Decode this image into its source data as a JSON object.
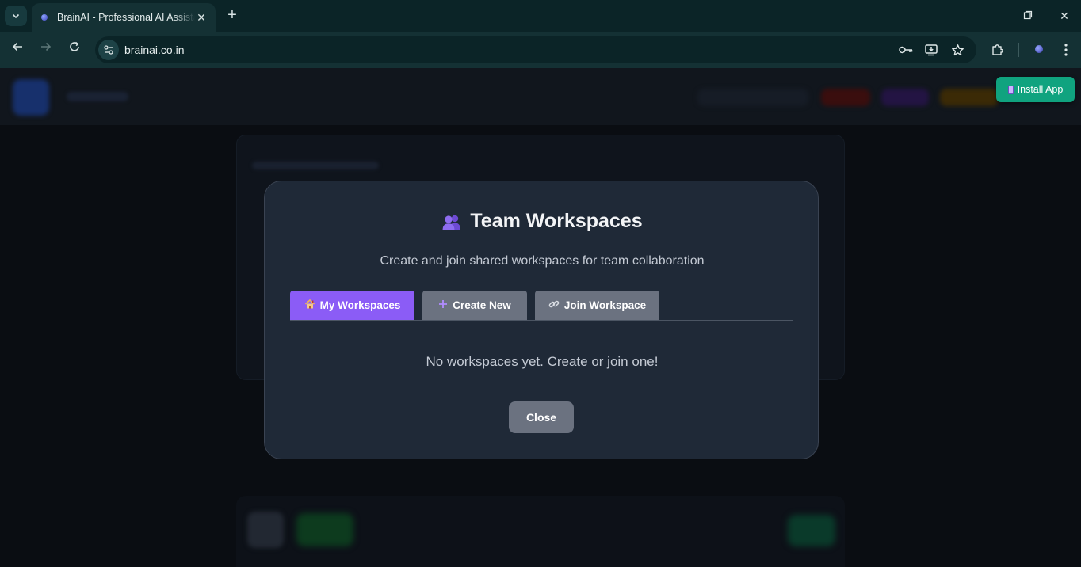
{
  "browser": {
    "tab_title": "BrainAI - Professional AI Assistant",
    "url": "brainai.co.in"
  },
  "install": {
    "label": "Install App"
  },
  "modal": {
    "title": "Team Workspaces",
    "subtitle": "Create and join shared workspaces for team collaboration",
    "tabs": [
      {
        "label": "My Workspaces",
        "icon": "house-icon",
        "active": true
      },
      {
        "label": "Create New",
        "icon": "plus-icon",
        "active": false
      },
      {
        "label": "Join Workspace",
        "icon": "link-icon",
        "active": false
      }
    ],
    "empty_message": "No workspaces yet. Create or join one!",
    "close_label": "Close"
  },
  "colors": {
    "accent": "#8b5cf6",
    "install": "#10a37f",
    "modal_bg": "#1f2937",
    "inactive_tab": "#6b7280"
  }
}
